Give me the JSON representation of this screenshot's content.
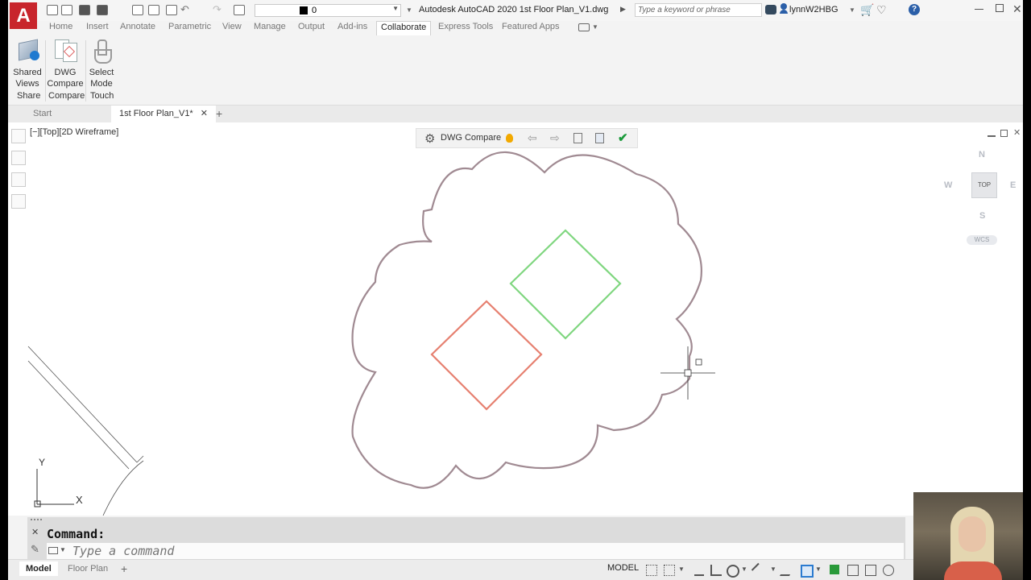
{
  "app": {
    "logo_letter": "A",
    "title": "Autodesk AutoCAD 2020    1st Floor Plan_V1.dwg",
    "layer_value": "0",
    "search_placeholder": "Type a keyword or phrase",
    "username": "lynnW2HBG",
    "accent_color": "#c8252c"
  },
  "ribbon": {
    "tabs": [
      "Home",
      "Insert",
      "Annotate",
      "Parametric",
      "View",
      "Manage",
      "Output",
      "Add-ins",
      "Collaborate",
      "Express Tools",
      "Featured Apps"
    ],
    "active_tab": "Collaborate",
    "buttons": [
      {
        "line1": "Shared",
        "line2": "Views",
        "icon": "shared-views-icon"
      },
      {
        "line1": "DWG",
        "line2": "Compare",
        "icon": "dwg-compare-icon"
      },
      {
        "line1": "Select",
        "line2": "Mode",
        "icon": "select-mode-icon"
      }
    ],
    "panels": [
      "Share",
      "Compare",
      "Touch"
    ]
  },
  "file_tabs": {
    "start": "Start",
    "drawing": "1st Floor Plan_V1*"
  },
  "viewport": {
    "label": "[−][Top][2D Wireframe]",
    "compare_toolbar_label": "DWG Compare"
  },
  "viewcube": {
    "north": "N",
    "south": "S",
    "east": "E",
    "west": "W",
    "top_face": "TOP",
    "wcs": "WCS"
  },
  "ucs": {
    "x_label": "X",
    "y_label": "Y"
  },
  "colors": {
    "added": "#7fd67f",
    "removed": "#e68070",
    "revcloud": "#a08a92"
  },
  "command": {
    "history": "Command:",
    "placeholder": "Type a command"
  },
  "status": {
    "layout_tabs": [
      "Model",
      "Floor Plan"
    ],
    "model_button": "MODEL"
  }
}
